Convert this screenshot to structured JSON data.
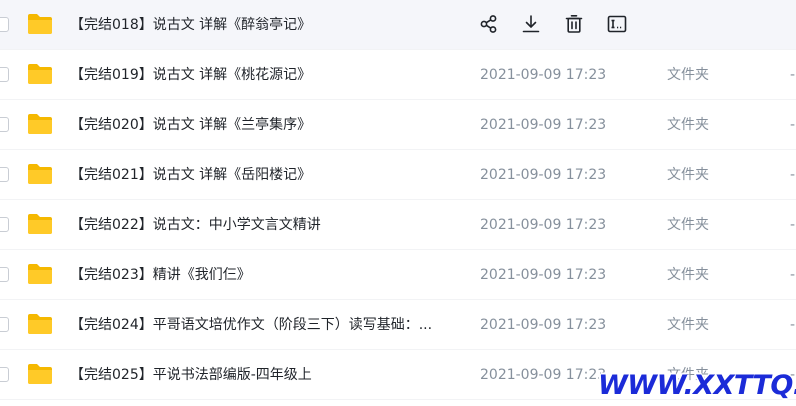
{
  "rows": [
    {
      "name": "【完结018】说古文  详解《醉翁亭记》",
      "modified": "",
      "type": "",
      "size": "",
      "hovered": true
    },
    {
      "name": "【完结019】说古文  详解《桃花源记》",
      "modified": "2021-09-09 17:23",
      "type": "文件夹",
      "size": "-"
    },
    {
      "name": "【完结020】说古文  详解《兰亭集序》",
      "modified": "2021-09-09 17:23",
      "type": "文件夹",
      "size": "-"
    },
    {
      "name": "【完结021】说古文  详解《岳阳楼记》",
      "modified": "2021-09-09 17:23",
      "type": "文件夹",
      "size": "-"
    },
    {
      "name": "【完结022】说古文：中小学文言文精讲",
      "modified": "2021-09-09 17:23",
      "type": "文件夹",
      "size": "-"
    },
    {
      "name": "【完结023】精讲《我们仨》",
      "modified": "2021-09-09 17:23",
      "type": "文件夹",
      "size": "-"
    },
    {
      "name": "【完结024】平哥语文培优作文（阶段三下）读写基础：...",
      "modified": "2021-09-09 17:23",
      "type": "文件夹",
      "size": "-"
    },
    {
      "name": "【完结025】平说书法部编版-四年级上",
      "modified": "2021-09-09 17:23",
      "type": "文件夹",
      "size": "-"
    }
  ],
  "hover_actions": [
    {
      "icon": "share-icon"
    },
    {
      "icon": "download-icon"
    },
    {
      "icon": "delete-icon"
    },
    {
      "icon": "rename-icon"
    }
  ],
  "colors": {
    "folder": "#ffca28",
    "folder_back": "#f5b800",
    "text": "#1f2329",
    "muted": "#86909c",
    "hover_bg": "#f5f6fa",
    "watermark": "#1b2bd8"
  },
  "watermark": "WWW.XXTTQ.COM"
}
